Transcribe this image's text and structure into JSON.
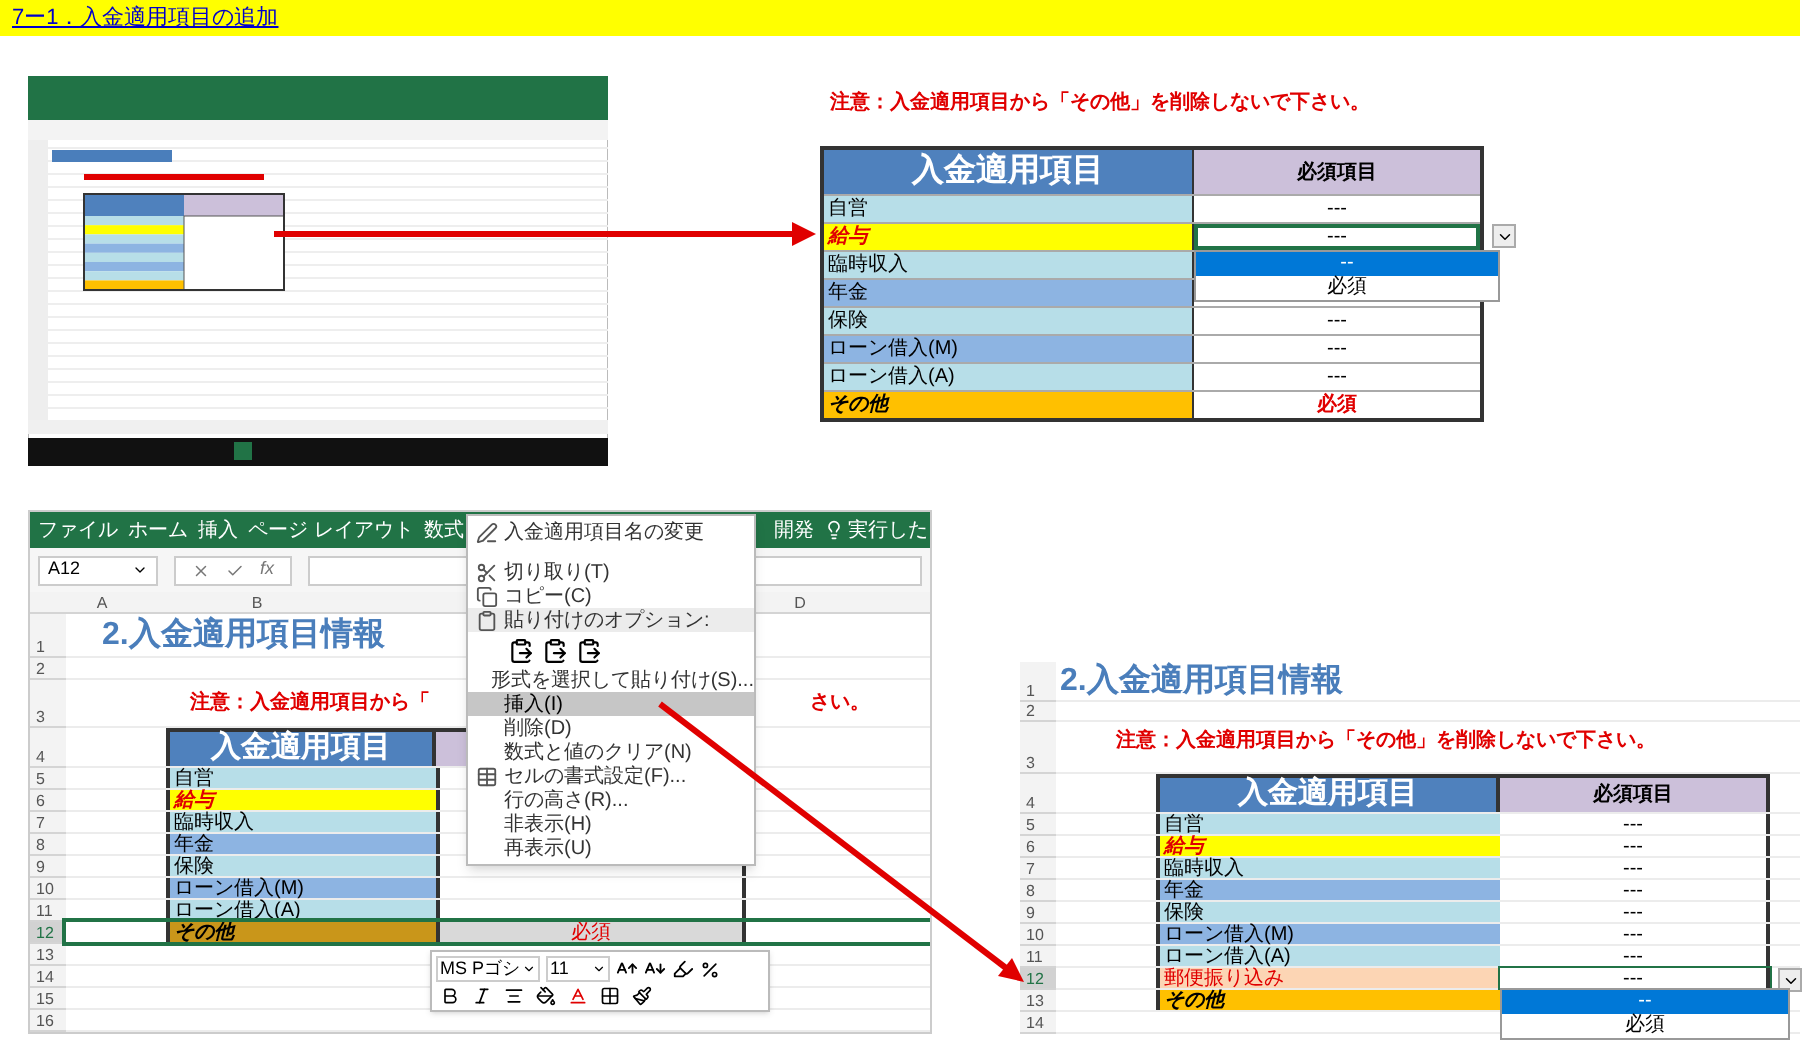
{
  "heading": "7ー1．入金適用項目の追加",
  "top_example": {
    "note": "注意：入金適用項目から「その他」を削除しないで下さい。",
    "columns": [
      "入金適用項目",
      "必須項目"
    ],
    "rows": [
      {
        "label": "自営",
        "value": "---",
        "kind": "light",
        "dropdown": false
      },
      {
        "label": "給与",
        "value": "---",
        "kind": "highlight",
        "dropdown": true
      },
      {
        "label": "臨時収入",
        "kind": "light",
        "dropdown": false
      },
      {
        "label": "年金",
        "kind": "mid",
        "dropdown": false
      },
      {
        "label": "保険",
        "value": "---",
        "kind": "light",
        "dropdown": false
      },
      {
        "label": "ローン借入(M)",
        "value": "---",
        "kind": "mid",
        "dropdown": false
      },
      {
        "label": "ローン借入(A)",
        "value": "---",
        "kind": "light",
        "dropdown": false
      },
      {
        "label": "その他",
        "value": "必須",
        "kind": "other",
        "dropdown": false
      }
    ],
    "dropdown_options": [
      {
        "label": "--",
        "selected": true
      },
      {
        "label": "必須",
        "selected": false
      }
    ]
  },
  "context_example": {
    "row_numbers": [
      "1",
      "2",
      "3",
      "4",
      "5",
      "6",
      "7",
      "8",
      "9",
      "10",
      "11",
      "12",
      "13",
      "14",
      "15",
      "16"
    ],
    "ribbon_tabs": [
      "ファイル",
      "ホーム",
      "挿入",
      "ページ レイアウト",
      "数式",
      "開発"
    ],
    "search_hint": "実行した",
    "name_box": "A12",
    "formula_label": "fx",
    "column_headers": [
      "A",
      "B",
      "D"
    ],
    "title": "2.入金適用項目情報",
    "note_visible_parts": [
      "注意：入金適用項目から「",
      "さい。"
    ],
    "table_header": "入金適用項目",
    "rows": [
      {
        "label": "自営",
        "kind": "light",
        "selected": false
      },
      {
        "label": "給与",
        "kind": "highlight",
        "selected": false
      },
      {
        "label": "臨時収入",
        "kind": "light",
        "selected": false
      },
      {
        "label": "年金",
        "kind": "mid",
        "selected": false
      },
      {
        "label": "保険",
        "kind": "light",
        "selected": false
      },
      {
        "label": "ローン借入(M)",
        "kind": "mid",
        "selected": false
      },
      {
        "label": "ローン借入(A)",
        "kind": "light",
        "selected": false
      },
      {
        "label": "その他",
        "value": "必須",
        "kind": "other",
        "selected": true
      }
    ],
    "context_menu": [
      {
        "kind": "rename",
        "label": "入金適用項目名の変更",
        "selected": false
      },
      {
        "kind": "cut",
        "label": "切り取り(T)",
        "selected": false
      },
      {
        "kind": "copy",
        "label": "コピー(C)",
        "selected": false
      },
      {
        "kind": "header",
        "label": "貼り付けのオプション:",
        "selected": false
      },
      {
        "kind": "paste_icons",
        "selected": false
      },
      {
        "kind": "item",
        "label": "形式を選択して貼り付け(S)...",
        "selected": false
      },
      {
        "kind": "item",
        "label": "挿入(I)",
        "selected": true
      },
      {
        "kind": "item",
        "label": "削除(D)",
        "selected": false
      },
      {
        "kind": "item",
        "label": "数式と値のクリア(N)",
        "selected": false
      },
      {
        "kind": "format",
        "label": "セルの書式設定(F)...",
        "selected": false
      },
      {
        "kind": "item",
        "label": "行の高さ(R)...",
        "selected": false
      },
      {
        "kind": "item",
        "label": "非表示(H)",
        "selected": false
      },
      {
        "kind": "item",
        "label": "再表示(U)",
        "selected": false
      }
    ],
    "mini_toolbar": {
      "font": "MS Pゴシ",
      "size": "11"
    }
  },
  "result_example": {
    "row_numbers": [
      "1",
      "2",
      "3",
      "4",
      "5",
      "6",
      "7",
      "8",
      "9",
      "10",
      "11",
      "12",
      "13",
      "14"
    ],
    "title": "2.入金適用項目情報",
    "note": "注意：入金適用項目から「その他」を削除しないで下さい。",
    "columns": [
      "入金適用項目",
      "必須項目"
    ],
    "rows": [
      {
        "label": "自営",
        "value": "---",
        "kind": "light",
        "selected": false
      },
      {
        "label": "給与",
        "value": "---",
        "kind": "highlight",
        "selected": false
      },
      {
        "label": "臨時収入",
        "value": "---",
        "kind": "light",
        "selected": false
      },
      {
        "label": "年金",
        "value": "---",
        "kind": "mid",
        "selected": false
      },
      {
        "label": "保険",
        "value": "---",
        "kind": "light",
        "selected": false
      },
      {
        "label": "ローン借入(M)",
        "value": "---",
        "kind": "mid",
        "selected": false
      },
      {
        "label": "ローン借入(A)",
        "value": "---",
        "kind": "light",
        "selected": false
      },
      {
        "label": "郵便振り込み",
        "value": "---",
        "kind": "new",
        "selected": true
      },
      {
        "label": "その他",
        "kind": "other",
        "selected": false
      }
    ],
    "dropdown_options": [
      {
        "label": "--",
        "selected": true
      },
      {
        "label": "必須",
        "selected": false
      }
    ]
  }
}
